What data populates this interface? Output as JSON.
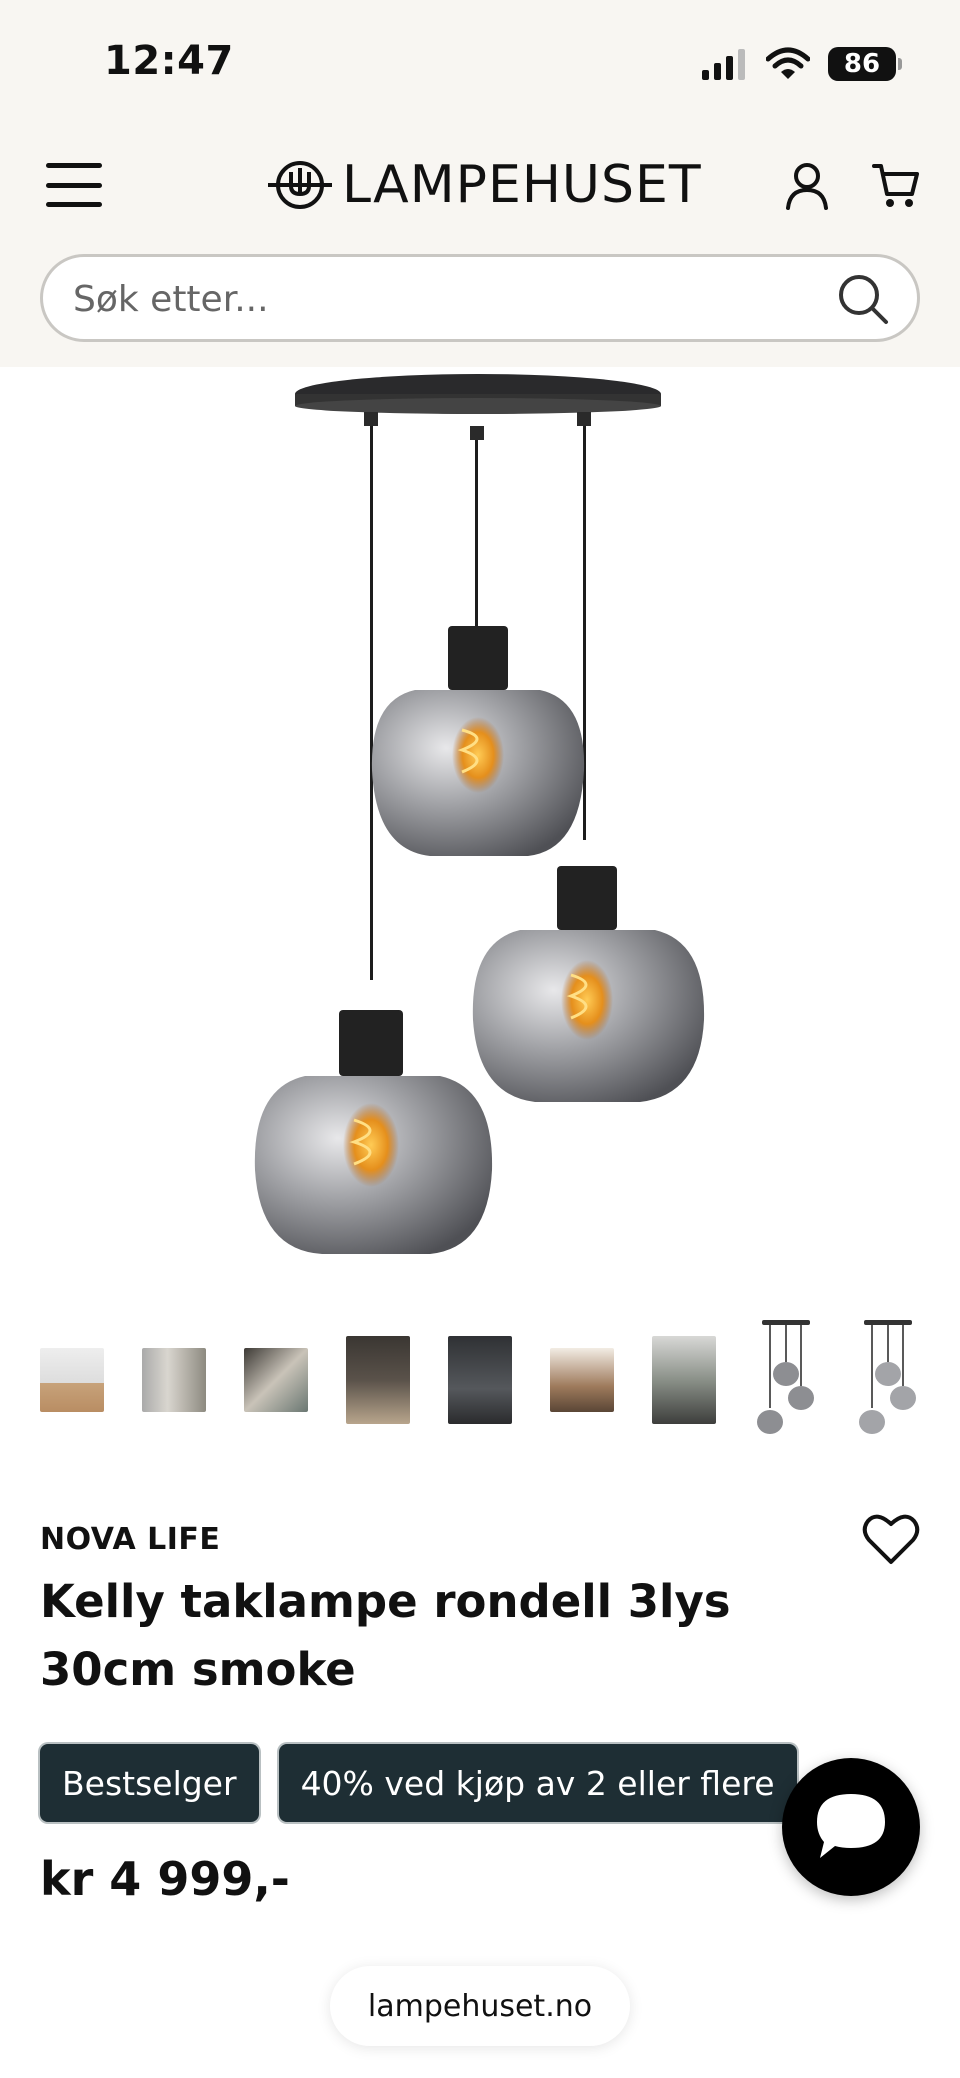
{
  "status_bar": {
    "time": "12:47",
    "battery": "86"
  },
  "header": {
    "logo_text": "LAMPEHUSET"
  },
  "search": {
    "placeholder": "Søk etter..."
  },
  "product": {
    "brand": "NOVA LIFE",
    "title": "Kelly taklampe rondell 3lys 30cm smoke",
    "badges": [
      "Bestselger",
      "40% ved kjøp av 2 eller flere"
    ],
    "price": "kr 4 999,-"
  },
  "gallery": {
    "thumbnail_count": 9,
    "main_image": "pendant-lamp-3-smoke-glass"
  },
  "browser": {
    "url": "lampehuset.no"
  },
  "colors": {
    "header_bg": "#f8f6f2",
    "badge_bg": "#1e2e34",
    "chat_bg": "#000000"
  }
}
